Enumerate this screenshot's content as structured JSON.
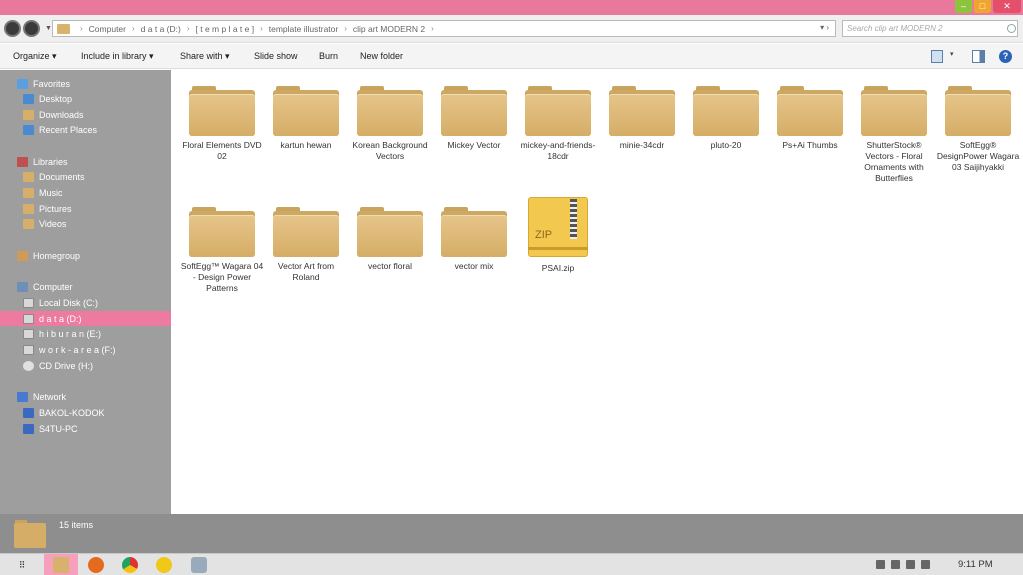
{
  "window": {
    "buttons": {
      "minimize": "–",
      "maximize": "□",
      "close": "✕"
    }
  },
  "address": {
    "breadcrumbs": [
      "Computer",
      "d a t a (D:)",
      "[ t e m p l a t e ]",
      "template illustrator",
      "clip art MODERN 2"
    ],
    "right_controls": "▾   ›",
    "search_placeholder": "Search clip art MODERN 2"
  },
  "toolbar": {
    "organize": "Organize ▾",
    "include_in_library": "Include in library ▾",
    "share_with": "Share with ▾",
    "slide_show": "Slide show",
    "burn": "Burn",
    "new_folder": "New folder",
    "help": "?",
    "view_drop": "▾"
  },
  "sidebar": {
    "favorites": "Favorites",
    "desktop": "Desktop",
    "downloads": "Downloads",
    "recent_places": "Recent Places",
    "libraries": "Libraries",
    "documents": "Documents",
    "music": "Music",
    "pictures": "Pictures",
    "videos": "Videos",
    "homegroup": "Homegroup",
    "computer": "Computer",
    "local_disk": "Local Disk (C:)",
    "data": "d a t a (D:)",
    "hiburan": "h i b u r a n (E:)",
    "work_area": "w o r k - a r e a (F:)",
    "cd_drive": "CD Drive (H:)",
    "network": "Network",
    "bakol_kodok": "BAKOL-KODOK",
    "s4tu_pc": "S4TU-PC"
  },
  "items": [
    "Floral Elements DVD 02",
    "kartun hewan",
    "Korean Background Vectors",
    "Mickey Vector",
    "mickey-and-friends-18cdr",
    "minie-34cdr",
    "pluto-20",
    "Ps+Ai Thumbs",
    "ShutterStock® Vectors - Floral Ornaments with Butterflies",
    "SoftEgg® DesignPower Wagara 03 Saijihyakki",
    "SoftEgg™ Wagara 04 - Design Power Patterns",
    "Vector Art from Roland",
    "vector floral",
    "vector mix",
    "PSAI.zip"
  ],
  "zip_label": "ZIP",
  "details": {
    "count": "15 items"
  },
  "taskbar": {
    "start": "⠿",
    "clock": "9:11 PM"
  }
}
